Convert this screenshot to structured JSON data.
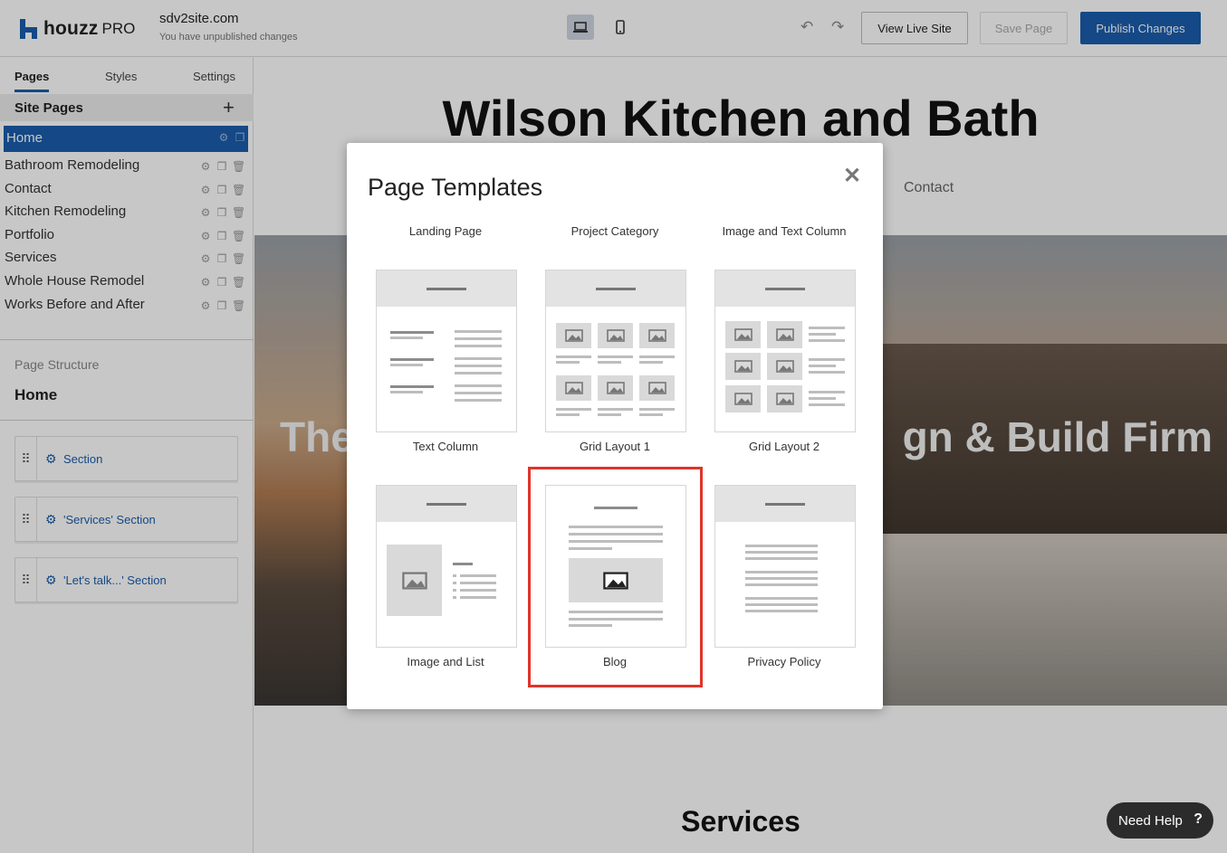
{
  "topbar": {
    "brand": "houzz",
    "brand_suffix": "PRO",
    "site_name": "sdv2site.com",
    "site_status": "You have unpublished changes",
    "view_live_label": "View Live Site",
    "save_label": "Save Page",
    "publish_label": "Publish Changes"
  },
  "sidebar": {
    "tabs": [
      "Pages",
      "Styles",
      "Settings"
    ],
    "site_pages_title": "Site Pages",
    "pages": [
      {
        "label": "Home",
        "active": true
      },
      {
        "label": "Bathroom Remodeling"
      },
      {
        "label": "Contact"
      },
      {
        "label": "Kitchen Remodeling"
      },
      {
        "label": "Portfolio"
      },
      {
        "label": "Services"
      },
      {
        "label": "Whole House Remodel"
      },
      {
        "label": "Works Before and After"
      }
    ],
    "structure_label": "Page Structure",
    "structure_page": "Home",
    "sections": [
      "Section",
      "'Services' Section",
      "'Let's talk...' Section"
    ]
  },
  "canvas": {
    "site_title": "Wilson Kitchen and Bath",
    "nav_contact": "Contact",
    "hero_left": "The",
    "hero_right": "gn & Build Firm",
    "services_heading": "Services"
  },
  "modal": {
    "title": "Page Templates",
    "close_icon": "close-icon",
    "templates": [
      {
        "name": "Landing Page"
      },
      {
        "name": "Project Category"
      },
      {
        "name": "Image and Text Column"
      },
      {
        "name": "Text Column"
      },
      {
        "name": "Grid Layout 1"
      },
      {
        "name": "Grid Layout 2"
      },
      {
        "name": "Image and List"
      },
      {
        "name": "Blog",
        "highlighted": true
      },
      {
        "name": "Privacy Policy"
      }
    ]
  },
  "help": {
    "label": "Need Help",
    "icon": "question-icon"
  },
  "colors": {
    "accent": "#1a5dac",
    "highlight": "#e0342a"
  }
}
